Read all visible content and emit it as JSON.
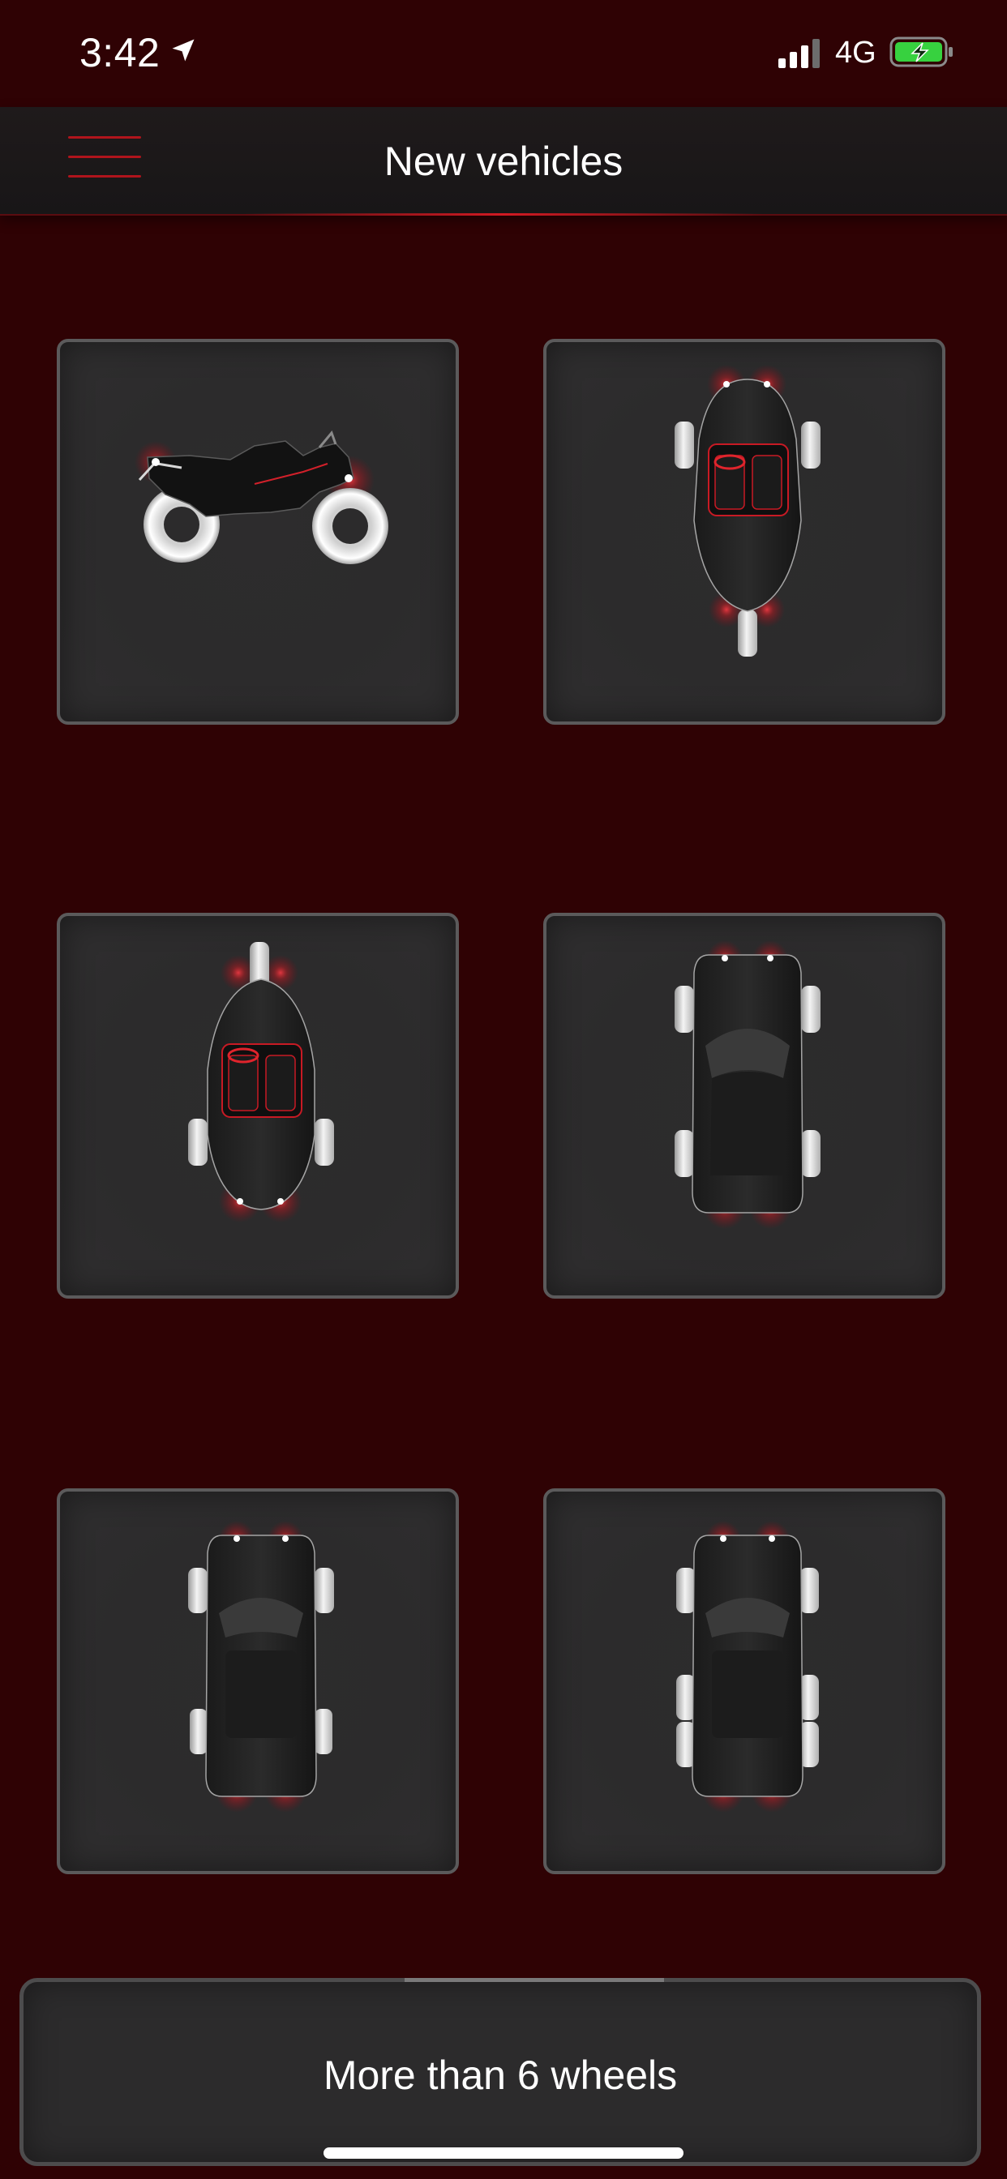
{
  "status_bar": {
    "time": "3:42",
    "network": "4G",
    "icons": [
      "location-arrow-icon",
      "signal-bars-icon",
      "battery-charging-icon"
    ]
  },
  "nav": {
    "title": "New vehicles",
    "menu_icon": "hamburger-menu-icon"
  },
  "vehicles": [
    {
      "id": "motorcycle",
      "icon": "motorcycle-icon"
    },
    {
      "id": "reverse-trike",
      "icon": "reverse-trike-icon"
    },
    {
      "id": "trike",
      "icon": "trike-icon"
    },
    {
      "id": "car",
      "icon": "four-wheel-car-icon"
    },
    {
      "id": "dually",
      "icon": "six-wheel-dually-icon"
    },
    {
      "id": "six-wheel",
      "icon": "six-wheel-car-icon"
    }
  ],
  "footer": {
    "more_label": "More than 6 wheels"
  },
  "colors": {
    "background": "#2f0204",
    "nav_bar": "#1c1a1b",
    "tile": "#2d2c2d",
    "tile_border": "#5b5a5b",
    "accent_red": "#e0242c",
    "wheel": "#e6e6e6"
  }
}
